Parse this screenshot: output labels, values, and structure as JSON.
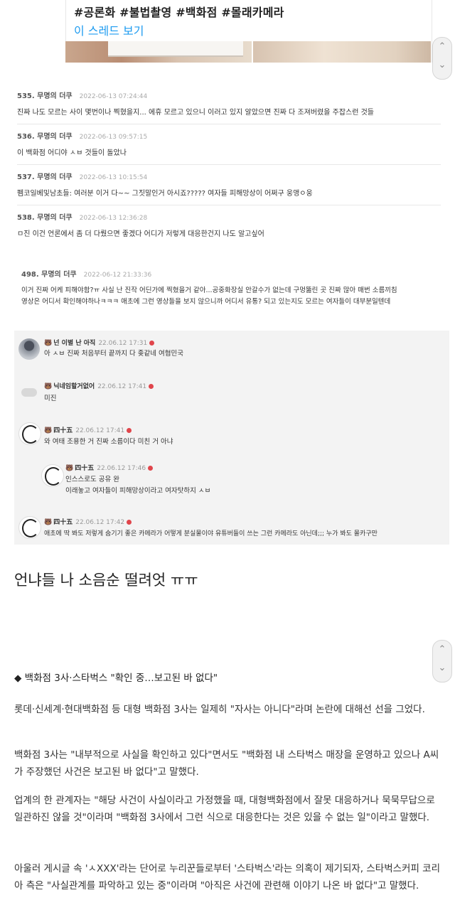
{
  "tweet": {
    "hashtags": "#공론화 #불법촬영 #백화점 #몰래카메라",
    "thread_link": "이 스레드 보기"
  },
  "scroll": {
    "up": "⌃",
    "down": "⌄"
  },
  "comments": [
    {
      "name": "535. 무명의 더쿠",
      "date": "2022-06-13 07:24:44",
      "text": "진짜 나도 모르는 사이 몇번이나 찍혔을지... 에휴 모르고 있으니 이러고 있지 알았으면 진짜 다 조져버렸을 주잡스런 것들"
    },
    {
      "name": "536. 무명의 더쿠",
      "date": "2022-06-13 09:57:15",
      "text": "이 백화점 어디야 ㅅㅂ 것들이 돌았나"
    },
    {
      "name": "537. 무명의 더쿠",
      "date": "2022-06-13 10:15:54",
      "text": "펨코일베및남초들: 여러분 이거 다~~ 그짓말인거 아시죠????? 여자들 피해망상이 어쩌구 웅앵ㅇ웅"
    },
    {
      "name": "538. 무명의 더쿠",
      "date": "2022-06-13 12:36:28",
      "text": "ㅁ진 이건 언론에서 좀 더 다뤘으면 좋겠다 어디가 저렇게 대응한건지 나도 알고싶어"
    },
    {
      "name": "498. 무명의 더쿠",
      "date": "2022-06-12 21:33:36",
      "text": "이거 진짜 어케 피해야함?ㅠ 사실 난 진작 어딘가에 찍혔을거 같아...공중화장실 안갈수가 없는데 구멍뚫린 곳 진짜 많아 매번 소름끼침",
      "text2": "영상은 어디서 확인해야하나ㅋㅋㅋ 애초에 그런 영상들을 보지 않으니까 어디서 유통? 되고 있는지도 모르는 여자들이 대부분일텐데"
    }
  ],
  "replies": [
    {
      "badge": "🐻",
      "name": "넌 이별 난 아직",
      "date": "22.06.12 17:31",
      "text": "아 ㅅㅂ 진짜 처음부터 끝까지 다 좆같네 여혐민국"
    },
    {
      "badge": "🐻",
      "name": "닉네임할거없어",
      "date": "22.06.12 17:41",
      "text": "미진"
    },
    {
      "badge": "🐻",
      "name": "四十五",
      "date": "22.06.12 17:41",
      "text": "와 여태 조용한 거 진짜 소름이다 미친 거 아냐"
    },
    {
      "badge": "🐻",
      "name": "四十五",
      "date": "22.06.12 17:46",
      "text": "인스스로도 공유 완",
      "text2": "이래놓고 여자들이 피해망상이라고 여자탓하지 ㅅㅂ"
    },
    {
      "badge": "🐻",
      "name": "四十五",
      "date": "22.06.12 17:42",
      "text": "애초에 딱 봐도 저렇게 숨기기 좋은 카메라가 어떻게 분실물이야 유튜버들이 쓰는 그런 카메라도 아닌데;;; 누가 봐도 몰카구만"
    }
  ],
  "caption": "언냐들 나 소음순 떨려엇 ㅠㅠ",
  "article": {
    "heading": "◆ 백화점 3사·스타벅스 \"확인 중…보고된 바 없다\"",
    "p1": "롯데·신세계·현대백화점 등 대형 백화점 3사는 일제히 \"자사는 아니다\"라며 논란에 대해선 선을 그었다.",
    "p2": "백화점 3사는 \"내부적으로 사실을 확인하고 있다\"면서도 \"백화점 내 스타벅스 매장을 운영하고 있으나 A씨가 주장했던 사건은 보고된 바 없다\"고 말했다.",
    "p3": "업계의 한 관계자는 \"해당 사건이 사실이라고 가정했을 때, 대형백화점에서 잘못 대응하거나 묵묵무답으로 일관하진 않을 것\"이라며 \"백화점 3사에서 그런 식으로 대응한다는 것은 있을 수 없는 일\"이라고 말했다.",
    "p4": "아울러 게시글 속 'ㅅXXX'라는 단어로 누리꾼들로부터 '스타벅스'라는 의혹이 제기되자, 스타벅스커피 코리아 측은 \"사실관계를 파악하고 있는 중\"이라며 \"아직은 사건에 관련해 이야기 나온 바 없다\"고 말했다."
  }
}
